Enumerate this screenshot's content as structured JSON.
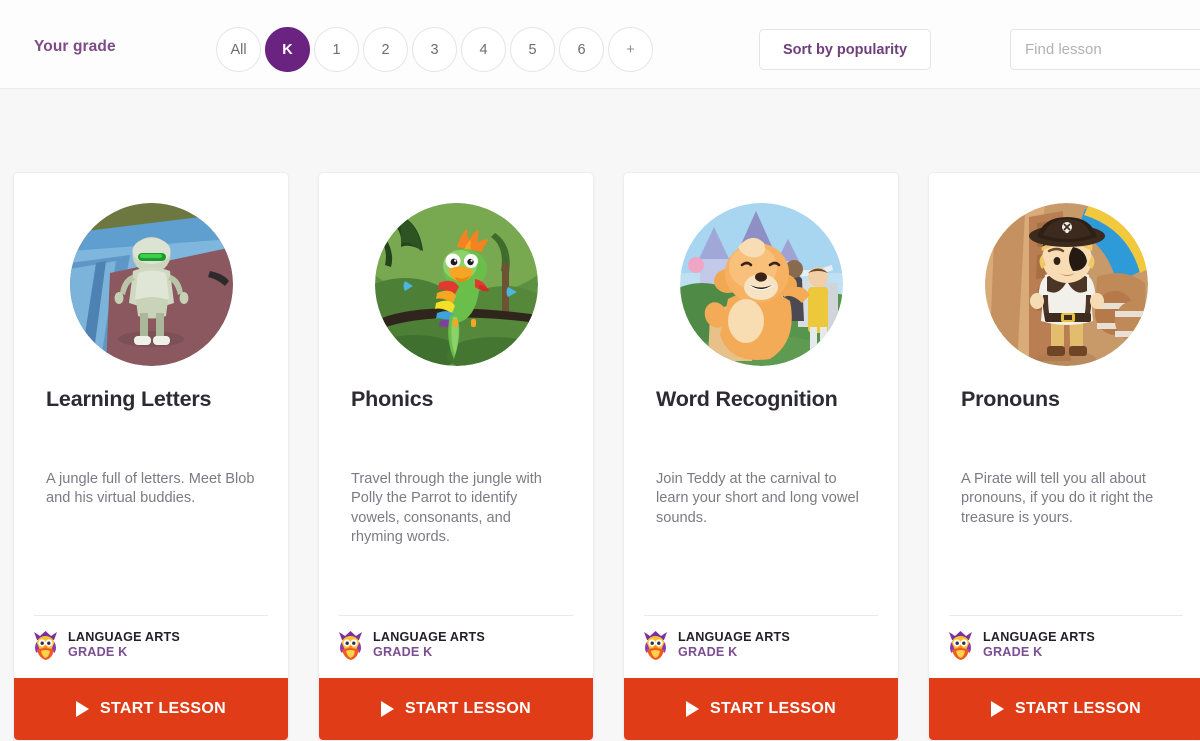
{
  "header": {
    "grade_label": "Your grade",
    "grade_pills": [
      {
        "label": "All",
        "active": false
      },
      {
        "label": "K",
        "active": true
      },
      {
        "label": "1",
        "active": false
      },
      {
        "label": "2",
        "active": false
      },
      {
        "label": "3",
        "active": false
      },
      {
        "label": "4",
        "active": false
      },
      {
        "label": "5",
        "active": false
      },
      {
        "label": "6",
        "active": false
      },
      {
        "label": "+",
        "active": false
      }
    ],
    "sort_label": "Sort by popularity",
    "search": {
      "value": "",
      "placeholder": "Find lesson"
    }
  },
  "colors": {
    "accent_purple": "#6a2380",
    "label_purple": "#7e4b86",
    "start_red": "#e03c18",
    "page_bg": "#f7f7f8",
    "title_text": "#2d2a33",
    "body_text": "#7d7a84"
  },
  "cards": [
    {
      "title": "Learning Letters",
      "description": "A jungle full of letters. Meet Blob and his virtual buddies.",
      "subject": "LANGUAGE ARTS",
      "grade": "GRADE K",
      "start_label": "START LESSON",
      "thumb_name": "blob-robot-thumbnail",
      "mascot_name": "owl-mascot-icon"
    },
    {
      "title": "Phonics",
      "description": "Travel through the jungle with Polly the Parrot to identify vowels, consonants, and rhyming words.",
      "subject": "LANGUAGE ARTS",
      "grade": "GRADE K",
      "start_label": "START LESSON",
      "thumb_name": "parrot-jungle-thumbnail",
      "mascot_name": "owl-mascot-icon"
    },
    {
      "title": "Word Recognition",
      "description": "Join Teddy at the carnival to learn your short and long vowel sounds.",
      "subject": "LANGUAGE ARTS",
      "grade": "GRADE K",
      "start_label": "START LESSON",
      "thumb_name": "teddy-bear-carnival-thumbnail",
      "mascot_name": "owl-mascot-icon"
    },
    {
      "title": "Pronouns",
      "description": "A Pirate will tell you all about pronouns, if you do it right the treasure is yours.",
      "subject": "LANGUAGE ARTS",
      "grade": "GRADE K",
      "start_label": "START LESSON",
      "thumb_name": "pirate-boy-thumbnail",
      "mascot_name": "owl-mascot-icon"
    }
  ]
}
